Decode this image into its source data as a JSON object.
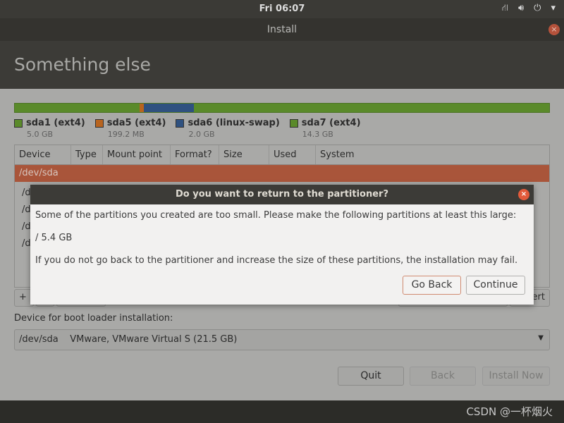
{
  "topbar": {
    "clock": "Fri 06:07",
    "icons": [
      "network-icon",
      "volume-icon",
      "power-icon",
      "chevron-down-icon"
    ]
  },
  "window": {
    "title": "Install",
    "close": "×"
  },
  "page_title": "Something else",
  "partitions": [
    {
      "name": "sda1 (ext4)",
      "size": "5.0 GB",
      "color": "#5a8a2a"
    },
    {
      "name": "sda5 (ext4)",
      "size": "199.2 MB",
      "color": "#b8641f"
    },
    {
      "name": "sda6 (linux-swap)",
      "size": "2.0 GB",
      "color": "#2f5180"
    },
    {
      "name": "sda7 (ext4)",
      "size": "14.3 GB",
      "color": "#5a8a2a"
    }
  ],
  "table": {
    "headers": [
      "Device",
      "Type",
      "Mount point",
      "Format?",
      "Size",
      "Used",
      "System"
    ],
    "selected": "/dev/sda",
    "rows": [
      "/d",
      "/d",
      "/d",
      "/d"
    ]
  },
  "table_buttons": {
    "add": "+",
    "revert_partial": "ert"
  },
  "boot": {
    "label": "Device for boot loader installation:",
    "value": "/dev/sda    VMware, VMware Virtual S (21.5 GB)"
  },
  "buttons": {
    "quit": "Quit",
    "back": "Back",
    "install": "Install Now"
  },
  "dialog": {
    "title": "Do you want to return to the partitioner?",
    "line1": "Some of the partitions you created are too small.  Please make the following partitions at least this large:",
    "line2": "/ 5.4 GB",
    "line3": "If you do not go back to the partitioner and increase the size of these partitions, the installation may fail.",
    "go_back": "Go Back",
    "continue": "Continue",
    "close": "×"
  },
  "watermark": "CSDN @一杯烟火"
}
